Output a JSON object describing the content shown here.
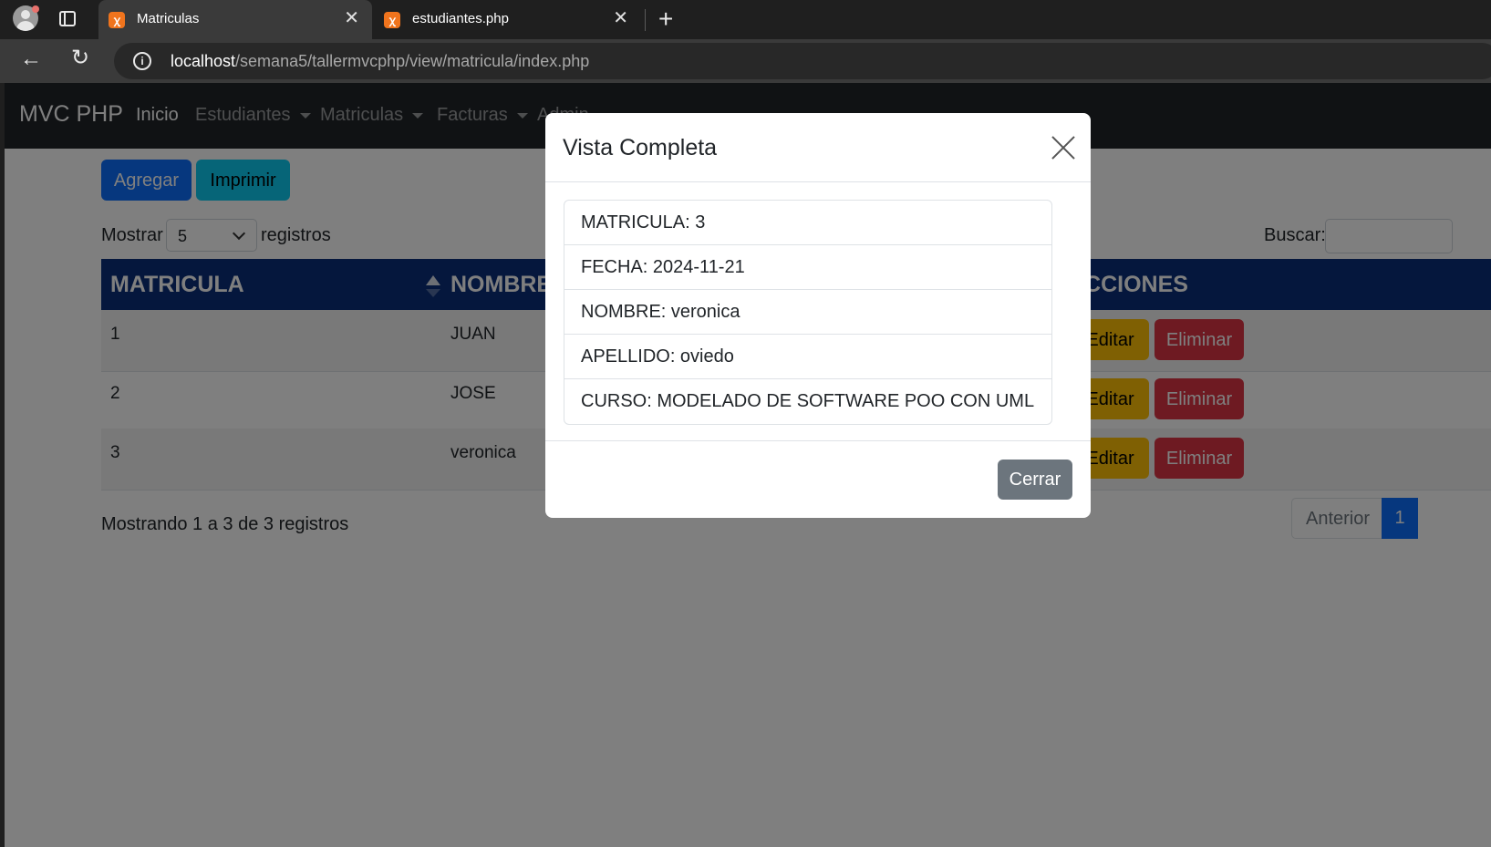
{
  "browser": {
    "tabs": [
      {
        "title": "Matriculas",
        "favicon": "xampp-icon"
      },
      {
        "title": "estudiantes.php",
        "favicon": "xampp-icon"
      }
    ],
    "url_host": "localhost",
    "url_path": "/semana5/tallermvcphp/view/matricula/index.php"
  },
  "navbar": {
    "brand": "MVC PHP",
    "items": [
      {
        "label": "Inicio"
      },
      {
        "label": "Estudiantes"
      },
      {
        "label": "Matriculas"
      },
      {
        "label": "Facturas"
      },
      {
        "label": "Admin"
      }
    ]
  },
  "actions": {
    "add": "Agregar",
    "print": "Imprimir"
  },
  "length_control": {
    "prefix": "Mostrar",
    "value": "5",
    "suffix": "registros"
  },
  "search": {
    "label": "Buscar:",
    "value": ""
  },
  "table": {
    "headers": [
      "MATRICULA",
      "NOMBRE",
      "ACCIONES"
    ],
    "rows": [
      {
        "matricula": "1",
        "nombre": "JUAN"
      },
      {
        "matricula": "2",
        "nombre": "JOSE"
      },
      {
        "matricula": "3",
        "nombre": "veronica"
      }
    ],
    "edit_label": "Editar",
    "delete_label": "Eliminar"
  },
  "footer": {
    "info": "Mostrando 1 a 3 de 3 registros",
    "prev": "Anterior",
    "page": "1"
  },
  "modal": {
    "title": "Vista Completa",
    "items": [
      "MATRICULA: 3",
      "FECHA: 2024-11-21",
      "NOMBRE: veronica",
      "APELLIDO: oviedo",
      "CURSO: MODELADO DE SOFTWARE POO CON UML"
    ],
    "close_label": "Cerrar"
  },
  "colors": {
    "navbar": "#212529",
    "table_header": "#0a2f7a",
    "primary": "#0d6efd",
    "info": "#0dcaf0",
    "warning": "#ffc107",
    "danger": "#dc3545",
    "secondary": "#6c757d"
  }
}
